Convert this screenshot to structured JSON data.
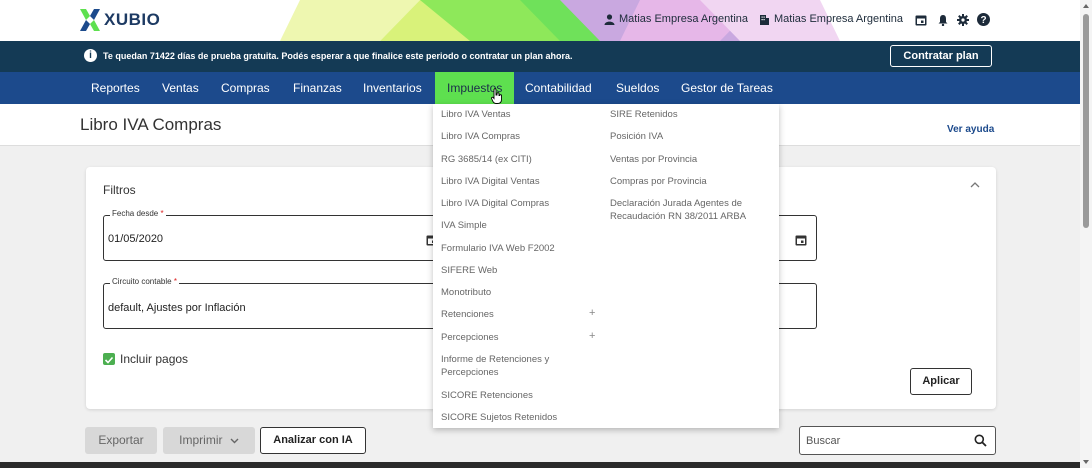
{
  "header": {
    "logo_text": "XUBIO",
    "user_name": "Matias Empresa Argentina",
    "company_name": "Matias Empresa Argentina"
  },
  "banner": {
    "message": "Te quedan 71422 días de prueba gratuita. Podés esperar a que finalice este periodo o contratar un plan ahora.",
    "cta_label": "Contratar plan"
  },
  "nav": {
    "items": [
      "Reportes",
      "Ventas",
      "Compras",
      "Finanzas",
      "Inventarios",
      "Impuestos",
      "Contabilidad",
      "Sueldos",
      "Gestor de Tareas"
    ],
    "active": "Impuestos"
  },
  "page": {
    "title": "Libro IVA Compras",
    "help_link": "Ver ayuda"
  },
  "filters": {
    "title": "Filtros",
    "fecha_desde_label": "Fecha desde",
    "fecha_desde_value": "01/05/2020",
    "circuito_label": "Circuito contable",
    "circuito_value": "default, Ajustes por Inflación",
    "incluir_pagos_label": "Incluir pagos",
    "required_mark": "*",
    "apply_label": "Aplicar"
  },
  "toolbar": {
    "export_label": "Exportar",
    "print_label": "Imprimir",
    "analyze_label": "Analizar con IA",
    "search_placeholder": "Buscar"
  },
  "dropdown": {
    "col1": [
      "Libro IVA Ventas",
      "Libro IVA Compras",
      "RG 3685/14 (ex CITI)",
      "Libro IVA Digital Ventas",
      "Libro IVA Digital Compras",
      "IVA Simple",
      "Formulario IVA Web F2002",
      "SIFERE Web",
      "Monotributo",
      "Retenciones",
      "Percepciones",
      "Informe de Retenciones y Percepciones",
      "SICORE Retenciones",
      "SICORE Sujetos Retenidos"
    ],
    "col2": [
      "SIRE Retenidos",
      "Posición IVA",
      "Ventas por Provincia",
      "Compras por Provincia",
      "Declaración Jurada Agentes de Recaudación RN 38/2011 ARBA"
    ],
    "expand_symbol": "+"
  },
  "colors": {
    "nav_bg": "#1c4a8c",
    "nav_active": "#5ee04f",
    "banner_bg": "#143a55"
  }
}
